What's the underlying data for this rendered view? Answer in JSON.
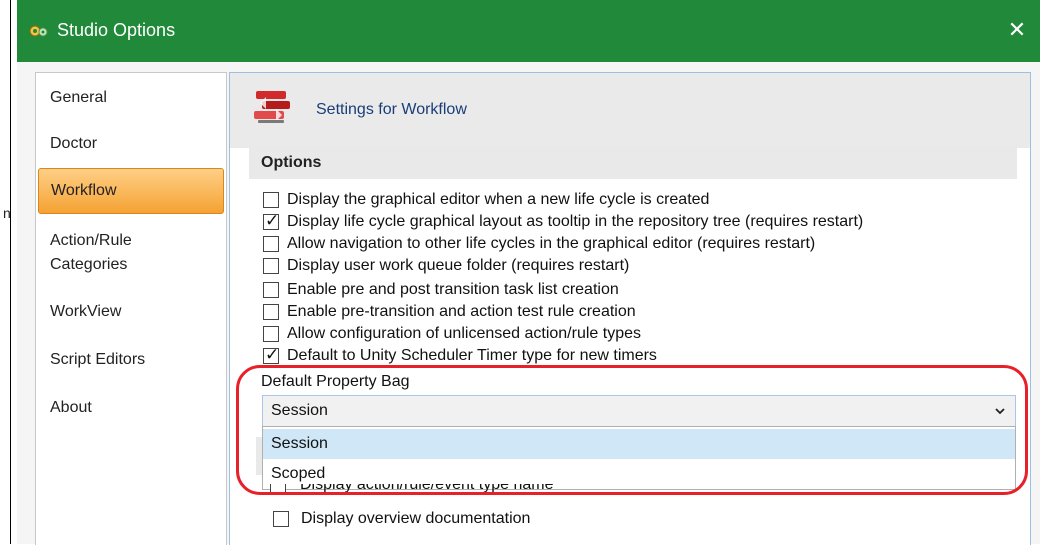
{
  "window": {
    "title": "Studio Options",
    "close_glyph": "✕"
  },
  "sidebar": {
    "items": [
      {
        "label": "General",
        "selected": false
      },
      {
        "label": "Doctor",
        "selected": false
      },
      {
        "label": "Workflow",
        "selected": true
      },
      {
        "label": "Action/Rule",
        "label2": "Categories",
        "selected": false
      },
      {
        "label": "WorkView",
        "selected": false
      },
      {
        "label": "Script Editors",
        "selected": false
      },
      {
        "label": "About",
        "selected": false
      }
    ]
  },
  "stray_char": "n",
  "content": {
    "settings_title": "Settings for Workflow",
    "options_header": "Options",
    "options": [
      {
        "label": "Display the graphical editor when a new life cycle is created",
        "checked": false
      },
      {
        "label": "Display life cycle graphical layout as tooltip in the repository tree (requires restart)",
        "checked": true
      },
      {
        "label": "Allow navigation to other life cycles in the graphical editor (requires restart)",
        "checked": false
      },
      {
        "label": "Display user work queue folder (requires restart)",
        "checked": false
      },
      {
        "label": "Enable pre and post transition task list creation",
        "checked": false
      },
      {
        "label": "Enable pre-transition and action test rule creation",
        "checked": false
      },
      {
        "label": "Allow configuration of unlicensed action/rule types",
        "checked": false
      },
      {
        "label": "Default to Unity Scheduler Timer type for new timers",
        "checked": true
      }
    ],
    "property_bag": {
      "label": "Default Property Bag",
      "selected": "Session",
      "options": [
        "Session",
        "Scoped"
      ]
    },
    "hidden_option": {
      "label": "Display action/rule/event type name",
      "checked": false
    },
    "last_option": {
      "label": "Display overview documentation",
      "checked": false
    }
  },
  "colors": {
    "titlebar": "#21893a",
    "selection": "#f5a233",
    "highlight_oval": "#e8202a",
    "dropdown_highlight": "#cfe7f7"
  },
  "icons": {
    "app": "gear-icon",
    "workflow": "workflow-icon",
    "close": "close-icon",
    "dropdown": "chevron-down-icon"
  }
}
